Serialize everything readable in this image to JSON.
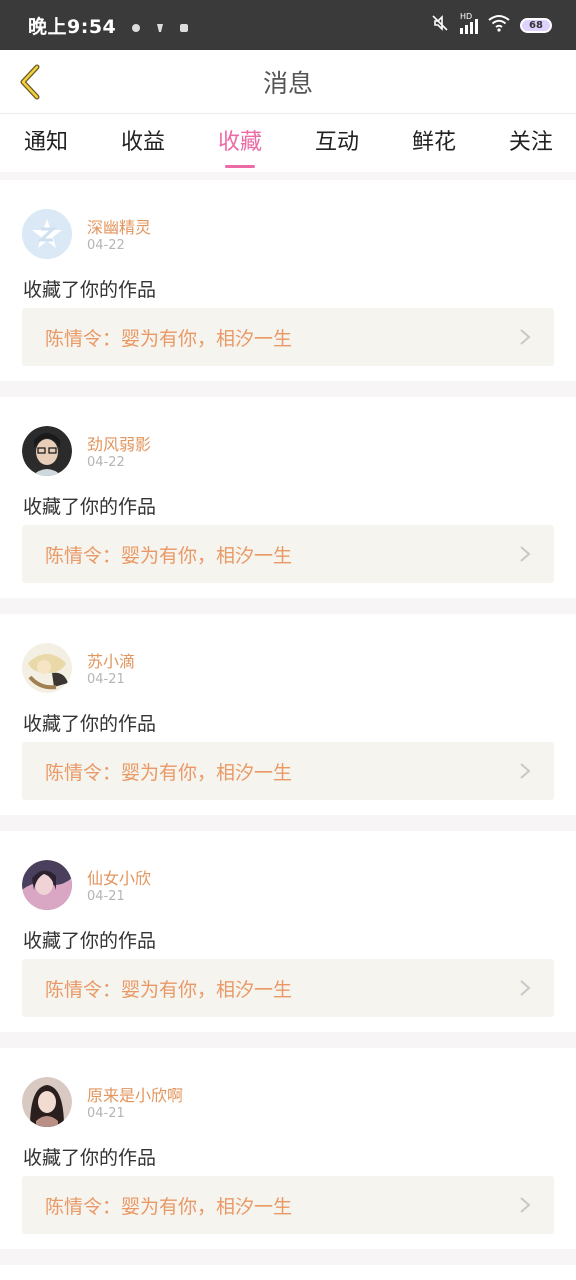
{
  "status_bar": {
    "time": "晚上9:54",
    "battery": "68",
    "signal_label": "HD"
  },
  "header": {
    "title": "消息",
    "back_icon": "chevron-left-icon"
  },
  "tabs": [
    {
      "label": "通知",
      "active": false
    },
    {
      "label": "收益",
      "active": false
    },
    {
      "label": "收藏",
      "active": true
    },
    {
      "label": "互动",
      "active": false
    },
    {
      "label": "鲜花",
      "active": false
    },
    {
      "label": "关注",
      "active": false
    }
  ],
  "colors": {
    "accent": "#ec6aa6",
    "username": "#e3955e",
    "work_title": "#ea9966",
    "work_bg": "#f5f4ee"
  },
  "messages": [
    {
      "username": "深幽精灵",
      "date": "04-22",
      "action": "收藏了你的作品",
      "work": "陈情令：婴为有你，相汐一生",
      "avatar": "qq-default-avatar"
    },
    {
      "username": "劲风弱影",
      "date": "04-22",
      "action": "收藏了你的作品",
      "work": "陈情令：婴为有你，相汐一生",
      "avatar": "user-photo-avatar"
    },
    {
      "username": "苏小滴",
      "date": "04-21",
      "action": "收藏了你的作品",
      "work": "陈情令：婴为有你，相汐一生",
      "avatar": "user-photo-avatar"
    },
    {
      "username": "仙女小欣",
      "date": "04-21",
      "action": "收藏了你的作品",
      "work": "陈情令：婴为有你，相汐一生",
      "avatar": "user-photo-avatar"
    },
    {
      "username": "原来是小欣啊",
      "date": "04-21",
      "action": "收藏了你的作品",
      "work": "陈情令：婴为有你，相汐一生",
      "avatar": "user-photo-avatar"
    }
  ]
}
